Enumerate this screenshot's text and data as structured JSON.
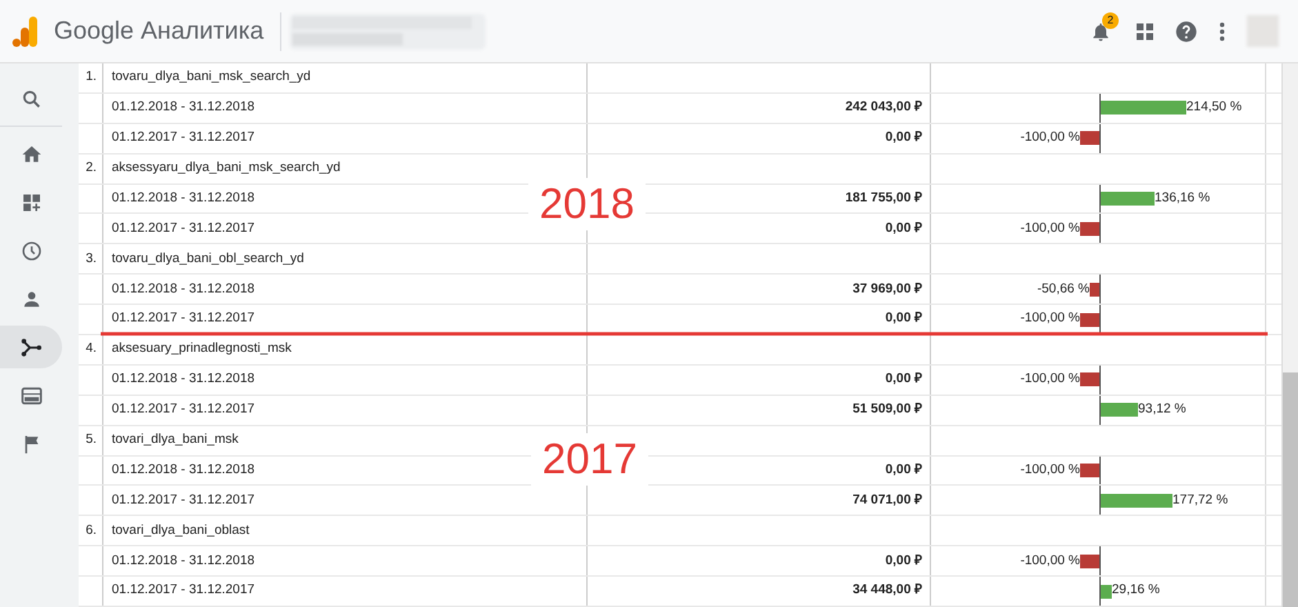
{
  "header": {
    "product": "Google Аналитика",
    "notifications_badge": "2"
  },
  "sidebar": {
    "items": [
      {
        "selected": false
      },
      {
        "selected": false
      },
      {
        "selected": false
      },
      {
        "selected": false
      },
      {
        "selected": false
      },
      {
        "selected": true
      },
      {
        "selected": false
      },
      {
        "selected": false
      }
    ]
  },
  "table": {
    "groups": [
      {
        "number": "1.",
        "name": "tovaru_dlya_bani_msk_search_yd",
        "rows": [
          {
            "period": "01.12.2018 - 31.12.2018",
            "value": "242 043,00 ₽",
            "change": "214,50 %",
            "kind": "positive"
          },
          {
            "period": "01.12.2017 - 31.12.2017",
            "value": "0,00 ₽",
            "change": "-100,00 %",
            "kind": "negative"
          }
        ]
      },
      {
        "number": "2.",
        "name": "aksessyaru_dlya_bani_msk_search_yd",
        "rows": [
          {
            "period": "01.12.2018 - 31.12.2018",
            "value": "181 755,00 ₽",
            "change": "136,16 %",
            "kind": "positive"
          },
          {
            "period": "01.12.2017 - 31.12.2017",
            "value": "0,00 ₽",
            "change": "-100,00 %",
            "kind": "negative"
          }
        ]
      },
      {
        "number": "3.",
        "name": "tovaru_dlya_bani_obl_search_yd",
        "rows": [
          {
            "period": "01.12.2018 - 31.12.2018",
            "value": "37 969,00 ₽",
            "change": "-50,66 %",
            "kind": "negative"
          },
          {
            "period": "01.12.2017 - 31.12.2017",
            "value": "0,00 ₽",
            "change": "-100,00 %",
            "kind": "negative"
          }
        ]
      },
      {
        "number": "4.",
        "name": "aksesuary_prinadlegnosti_msk",
        "rows": [
          {
            "period": "01.12.2018 - 31.12.2018",
            "value": "0,00 ₽",
            "change": "-100,00 %",
            "kind": "negative"
          },
          {
            "period": "01.12.2017 - 31.12.2017",
            "value": "51 509,00 ₽",
            "change": "93,12 %",
            "kind": "positive"
          }
        ]
      },
      {
        "number": "5.",
        "name": "tovari_dlya_bani_msk",
        "rows": [
          {
            "period": "01.12.2018 - 31.12.2018",
            "value": "0,00 ₽",
            "change": "-100,00 %",
            "kind": "negative"
          },
          {
            "period": "01.12.2017 - 31.12.2017",
            "value": "74 071,00 ₽",
            "change": "177,72 %",
            "kind": "positive"
          }
        ]
      },
      {
        "number": "6.",
        "name": "tovari_dlya_bani_oblast",
        "rows": [
          {
            "period": "01.12.2018 - 31.12.2018",
            "value": "0,00 ₽",
            "change": "-100,00 %",
            "kind": "negative"
          },
          {
            "period": "01.12.2017 - 31.12.2017",
            "value": "34 448,00 ₽",
            "change": "29,16 %",
            "kind": "positive"
          }
        ]
      }
    ]
  },
  "annotations": [
    {
      "text": "2018"
    },
    {
      "text": "2017"
    }
  ]
}
